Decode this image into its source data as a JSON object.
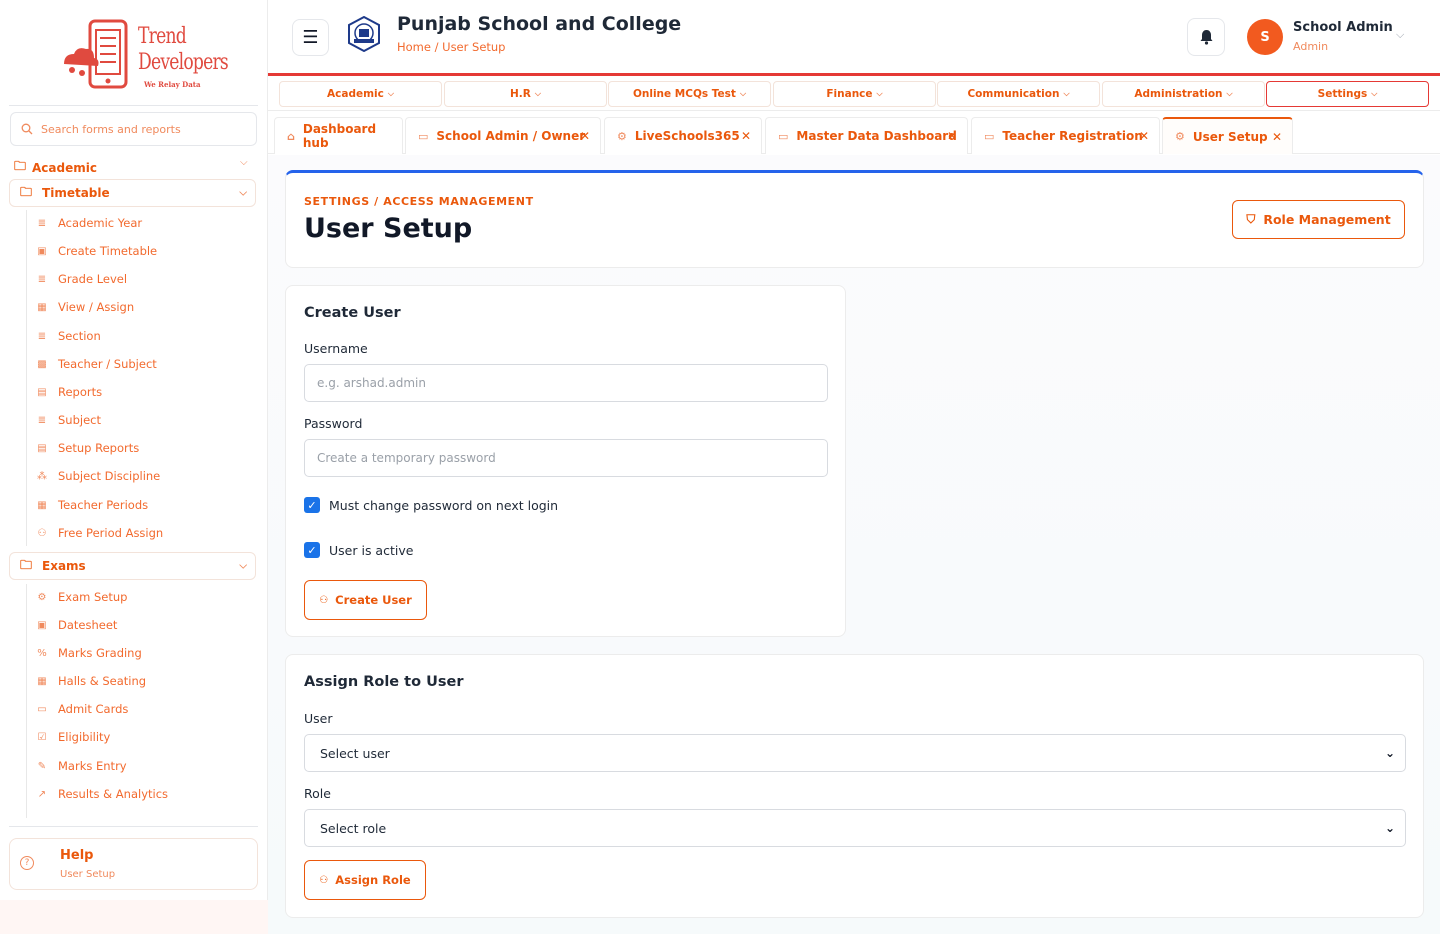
{
  "brand": {
    "line1": "Trend",
    "line2": "Developers",
    "tagline": "We Relay Data"
  },
  "search": {
    "placeholder": "Search forms and reports"
  },
  "sidebar": {
    "academic_label": "Academic",
    "timetable_label": "Timetable",
    "timetable_items": [
      "Academic Year",
      "Create Timetable",
      "Grade Level",
      "View / Assign",
      "Section",
      "Teacher / Subject",
      "Reports",
      "Subject",
      "Setup Reports",
      "Subject Discipline",
      "Teacher Periods",
      "Free Period Assign"
    ],
    "exams_label": "Exams",
    "exams_items": [
      "Exam Setup",
      "Datesheet",
      "Marks Grading",
      "Halls & Seating",
      "Admit Cards",
      "Eligibility",
      "Marks Entry",
      "Results & Analytics"
    ],
    "help": {
      "title": "Help",
      "subtitle": "User Setup"
    }
  },
  "header": {
    "school_name": "Punjab School and College",
    "breadcrumb": "Home / User Setup",
    "user_name": "School Admin",
    "user_role": "Admin",
    "avatar_initial": "S"
  },
  "modules": [
    "Academic",
    "H.R",
    "Online MCQs Test",
    "Finance",
    "Communication",
    "Administration",
    "Settings"
  ],
  "tabs": [
    "Dashboard hub",
    "School Admin / Owner",
    "LiveSchools365",
    "Master Data Dashboard",
    "Teacher Registration",
    "User Setup"
  ],
  "page": {
    "kicker": "SETTINGS / ACCESS MANAGEMENT",
    "title": "User Setup",
    "role_button": "Role Management"
  },
  "create_user": {
    "title": "Create User",
    "username_label": "Username",
    "username_placeholder": "e.g. arshad.admin",
    "password_label": "Password",
    "password_placeholder": "Create a temporary password",
    "must_change_label": "Must change password on next login",
    "active_label": "User is active",
    "button": "Create User"
  },
  "assign_role": {
    "title": "Assign Role to User",
    "user_label": "User",
    "user_value": "Select user",
    "role_label": "Role",
    "role_value": "Select role",
    "button": "Assign Role"
  },
  "colors": {
    "accent": "#ea580c",
    "header_rule": "#e53935",
    "title_border": "#2563eb",
    "checkbox": "#1a73e8"
  }
}
